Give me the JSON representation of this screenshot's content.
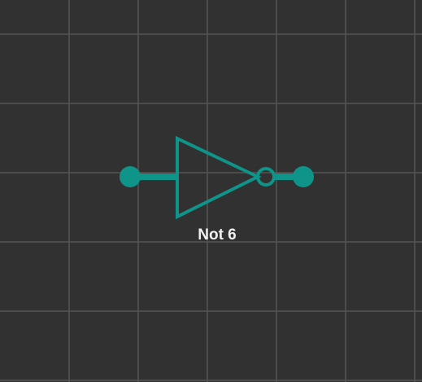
{
  "component": {
    "type": "not-gate",
    "label": "Not 6"
  },
  "colors": {
    "background": "#313131",
    "grid_line": "#555555",
    "wire": "#0e9488",
    "label_text": "#f0f0f0"
  }
}
